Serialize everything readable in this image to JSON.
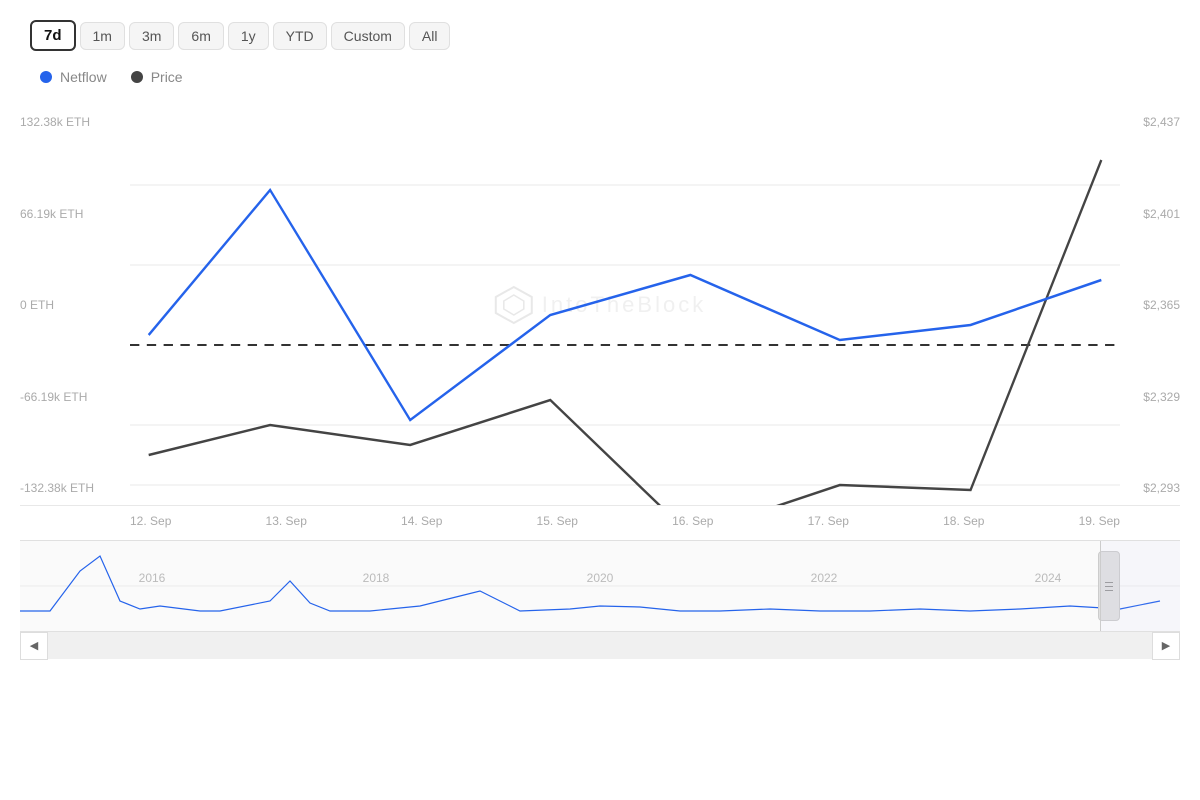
{
  "timeRange": {
    "buttons": [
      "7d",
      "1m",
      "3m",
      "6m",
      "1y",
      "YTD",
      "Custom",
      "All"
    ],
    "active": "7d"
  },
  "legend": {
    "items": [
      {
        "id": "netflow",
        "label": "Netflow",
        "color": "blue"
      },
      {
        "id": "price",
        "label": "Price",
        "color": "dark"
      }
    ]
  },
  "yAxisLeft": {
    "labels": [
      "132.38k ETH",
      "66.19k ETH",
      "0 ETH",
      "-66.19k ETH",
      "-132.38k ETH"
    ]
  },
  "yAxisRight": {
    "labels": [
      "$2,437",
      "$2,401",
      "$2,365",
      "$2,329",
      "$2,293"
    ]
  },
  "xAxis": {
    "labels": [
      "12. Sep",
      "13. Sep",
      "14. Sep",
      "15. Sep",
      "16. Sep",
      "17. Sep",
      "18. Sep",
      "19. Sep"
    ]
  },
  "navYearLabels": [
    "2016",
    "2018",
    "2020",
    "2022",
    "2024"
  ],
  "scrollBar": {
    "leftArrow": "◀",
    "rightArrow": "▶"
  },
  "watermark": "IntoTheBlock"
}
